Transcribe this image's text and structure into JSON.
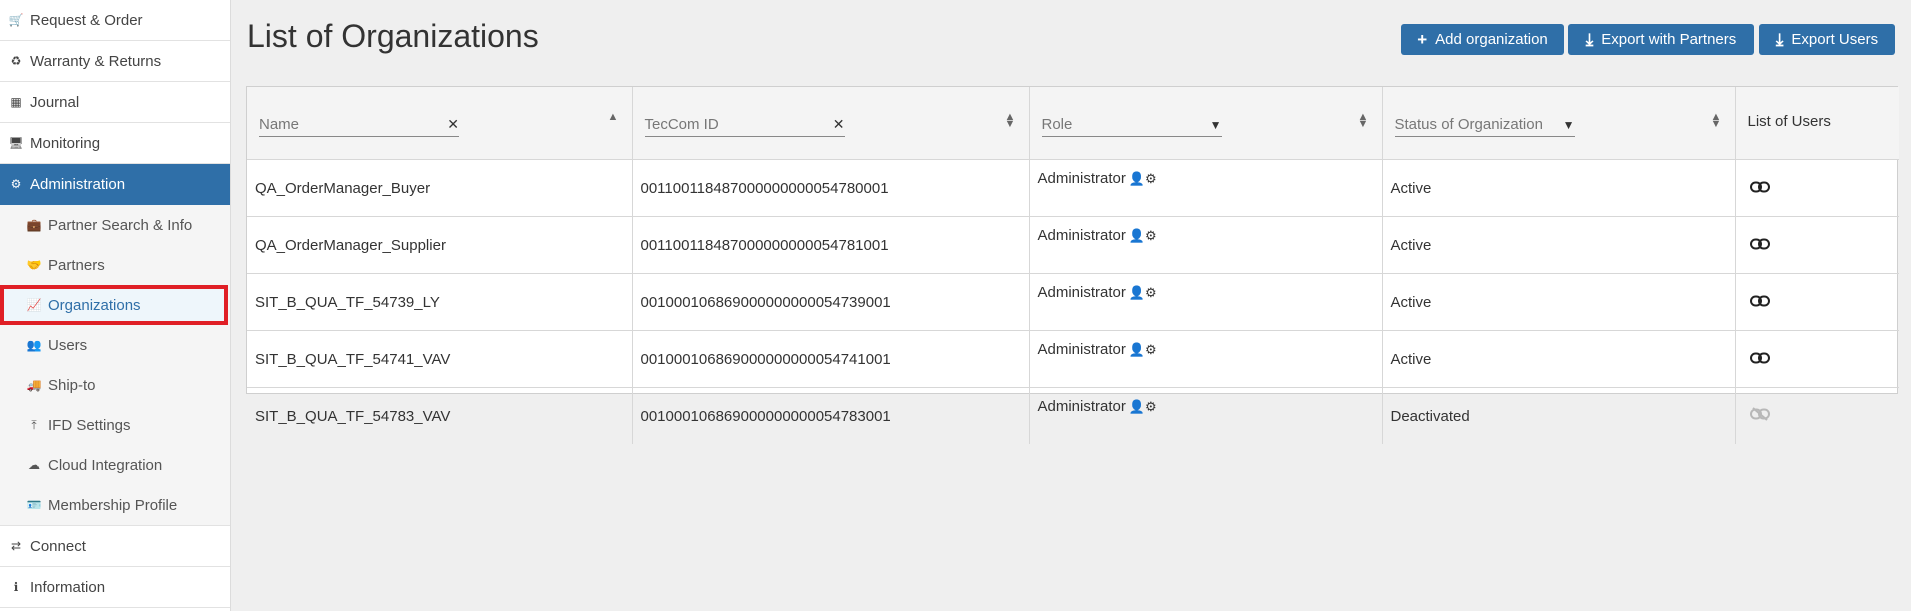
{
  "sidebar": {
    "top_items": [
      {
        "label": "Request & Order",
        "icon": "cart-icon"
      },
      {
        "label": "Warranty & Returns",
        "icon": "recycle-icon"
      },
      {
        "label": "Journal",
        "icon": "table-icon"
      },
      {
        "label": "Monitoring",
        "icon": "monitor-icon"
      },
      {
        "label": "Administration",
        "icon": "gear-icon"
      }
    ],
    "sub_items": [
      {
        "label": "Partner Search & Info",
        "icon": "briefcase-icon"
      },
      {
        "label": "Partners",
        "icon": "handshake-icon"
      },
      {
        "label": "Organizations",
        "icon": "chart-icon"
      },
      {
        "label": "Users",
        "icon": "users-icon"
      },
      {
        "label": "Ship-to",
        "icon": "truck-icon"
      },
      {
        "label": "IFD Settings",
        "icon": "upload-icon"
      },
      {
        "label": "Cloud Integration",
        "icon": "cloud-icon"
      },
      {
        "label": "Membership Profile",
        "icon": "id-card-icon"
      }
    ],
    "bottom_items": [
      {
        "label": "Connect",
        "icon": "exchange-icon"
      },
      {
        "label": "Information",
        "icon": "info-icon"
      }
    ]
  },
  "header": {
    "title": "List of Organizations",
    "buttons": {
      "add": "Add organization",
      "export_partners": "Export with Partners",
      "export_users": "Export Users"
    }
  },
  "table": {
    "filters": {
      "name": "Name",
      "teccom_id": "TecCom ID",
      "role": "Role",
      "status": "Status of Organization"
    },
    "list_of_users_header": "List of Users",
    "rows": [
      {
        "name": "QA_OrderManager_Buyer",
        "teccom_id": "001100118487000000000054780001",
        "role": "Administrator",
        "status": "Active",
        "link_active": true
      },
      {
        "name": "QA_OrderManager_Supplier",
        "teccom_id": "001100118487000000000054781001",
        "role": "Administrator",
        "status": "Active",
        "link_active": true
      },
      {
        "name": "SIT_B_QUA_TF_54739_LY",
        "teccom_id": "001000106869000000000054739001",
        "role": "Administrator",
        "status": "Active",
        "link_active": true
      },
      {
        "name": "SIT_B_QUA_TF_54741_VAV",
        "teccom_id": "001000106869000000000054741001",
        "role": "Administrator",
        "status": "Active",
        "link_active": true
      },
      {
        "name": "SIT_B_QUA_TF_54783_VAV",
        "teccom_id": "001000106869000000000054783001",
        "role": "Administrator",
        "status": "Deactivated",
        "link_active": false
      }
    ]
  },
  "colors": {
    "accent": "#2f6fa8",
    "highlight_border": "#e01f26"
  }
}
